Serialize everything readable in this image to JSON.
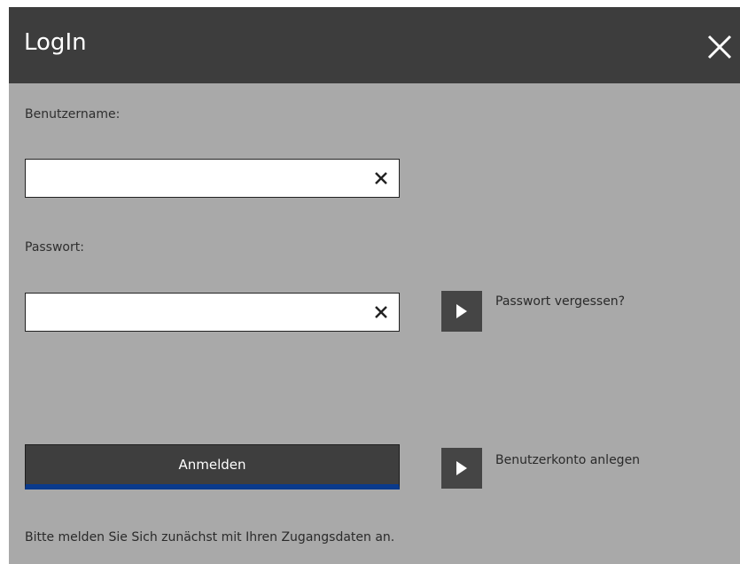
{
  "dialog": {
    "title": "LogIn",
    "close_icon": "close-icon"
  },
  "username": {
    "label": "Benutzername:",
    "value": "",
    "placeholder": "",
    "clear_icon": "clear-x-icon"
  },
  "password": {
    "label": "Passwort:",
    "value": "",
    "placeholder": "",
    "clear_icon": "clear-x-icon"
  },
  "links": {
    "forgot_password": "Passwort vergessen?",
    "create_account": "Benutzerkonto anlegen",
    "arrow_icon": "play-arrow-icon"
  },
  "actions": {
    "login_label": "Anmelden"
  },
  "status": {
    "hint": "Bitte melden Sie Sich zunächst mit Ihren Zugangsdaten an."
  },
  "colors": {
    "titlebar": "#3d3d3d",
    "background": "#a9a9a9",
    "button": "#3e3e3e",
    "button_accent": "#0a3a8c"
  }
}
